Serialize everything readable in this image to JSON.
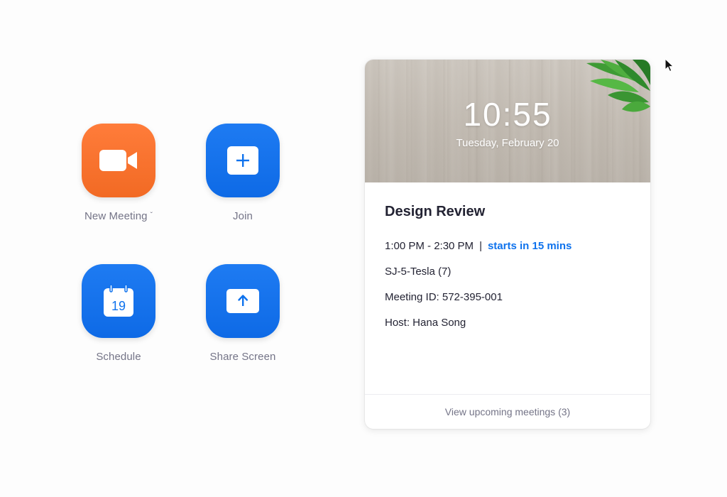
{
  "actions": [
    {
      "label": "New Meeting",
      "icon": "video-camera-icon",
      "color": "#f26d21",
      "has_dropdown": true
    },
    {
      "label": "Join",
      "icon": "plus-icon",
      "color": "#0e72ed"
    },
    {
      "label": "Schedule",
      "icon": "calendar-icon",
      "color": "#0e72ed",
      "calendar_day": "19"
    },
    {
      "label": "Share Screen",
      "icon": "share-up-arrow-icon",
      "color": "#0e72ed"
    }
  ],
  "card": {
    "time": "10:55",
    "date": "Tuesday, February 20",
    "meeting": {
      "title": "Design Review",
      "time_range": "1:00 PM - 2:30 PM",
      "separator": "|",
      "starts_in": "starts in 15 mins",
      "room": "SJ-5-Tesla (7)",
      "meeting_id": "Meeting ID: 572-395-001",
      "host": "Host: Hana Song"
    },
    "footer": "View upcoming meetings (3)"
  },
  "colors": {
    "accent_blue": "#0e72ed",
    "accent_orange": "#f26d21",
    "label_gray": "#747487"
  }
}
